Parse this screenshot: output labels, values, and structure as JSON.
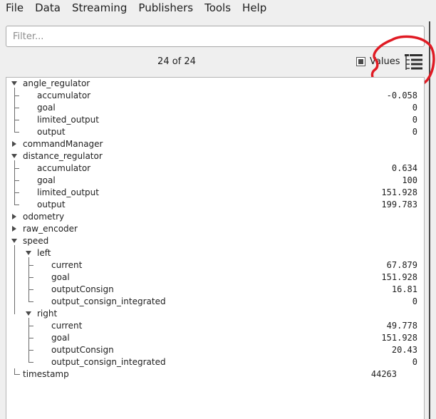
{
  "menu": [
    "File",
    "Data",
    "Streaming",
    "Publishers",
    "Tools",
    "Help"
  ],
  "filter": {
    "placeholder": "Filter...",
    "value": ""
  },
  "count_label": "24 of 24",
  "values_toggle": {
    "label": "Values",
    "checked": true
  },
  "tree_button_icon": "tree-view-icon",
  "annotation_color": "#e01b24",
  "tree": [
    {
      "label": "angle_regulator",
      "depth": 0,
      "expand": "open"
    },
    {
      "label": "accumulator",
      "depth": 1,
      "value": "-0.058"
    },
    {
      "label": "goal",
      "depth": 1,
      "value": "0"
    },
    {
      "label": "limited_output",
      "depth": 1,
      "value": "0"
    },
    {
      "label": "output",
      "depth": 1,
      "value": "0"
    },
    {
      "label": "commandManager",
      "depth": 0,
      "expand": "closed"
    },
    {
      "label": "distance_regulator",
      "depth": 0,
      "expand": "open"
    },
    {
      "label": "accumulator",
      "depth": 1,
      "value": "0.634"
    },
    {
      "label": "goal",
      "depth": 1,
      "value": "100"
    },
    {
      "label": "limited_output",
      "depth": 1,
      "value": "151.928"
    },
    {
      "label": "output",
      "depth": 1,
      "value": "199.783"
    },
    {
      "label": "odometry",
      "depth": 0,
      "expand": "closed"
    },
    {
      "label": "raw_encoder",
      "depth": 0,
      "expand": "closed"
    },
    {
      "label": "speed",
      "depth": 0,
      "expand": "open"
    },
    {
      "label": "left",
      "depth": 1,
      "expand": "open"
    },
    {
      "label": "current",
      "depth": 2,
      "value": "67.879"
    },
    {
      "label": "goal",
      "depth": 2,
      "value": "151.928"
    },
    {
      "label": "outputConsign",
      "depth": 2,
      "value": "16.81"
    },
    {
      "label": "output_consign_integrated",
      "depth": 2,
      "value": "0"
    },
    {
      "label": "right",
      "depth": 1,
      "expand": "open"
    },
    {
      "label": "current",
      "depth": 2,
      "value": "49.778"
    },
    {
      "label": "goal",
      "depth": 2,
      "value": "151.928"
    },
    {
      "label": "outputConsign",
      "depth": 2,
      "value": "20.43"
    },
    {
      "label": "output_consign_integrated",
      "depth": 2,
      "value": "0"
    },
    {
      "label": "timestamp",
      "depth": 0,
      "value": "44263"
    }
  ]
}
